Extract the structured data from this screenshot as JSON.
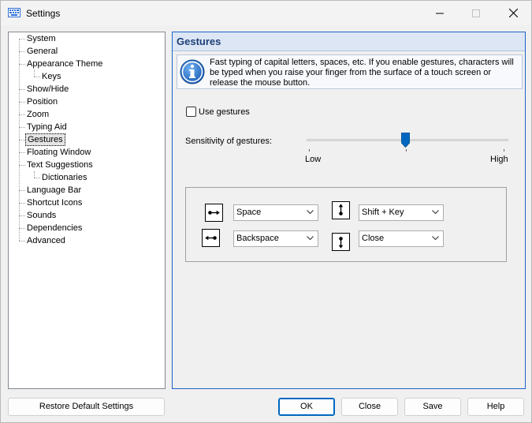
{
  "window": {
    "title": "Settings",
    "minimize_icon": "minimize-icon",
    "maximize_icon": "maximize-icon",
    "close_icon": "close-icon"
  },
  "tree": {
    "items": [
      {
        "label": "System"
      },
      {
        "label": "General"
      },
      {
        "label": "Appearance Theme"
      },
      {
        "label": "Keys"
      },
      {
        "label": "Show/Hide"
      },
      {
        "label": "Position"
      },
      {
        "label": "Zoom"
      },
      {
        "label": "Typing Aid"
      },
      {
        "label": "Gestures",
        "selected": true
      },
      {
        "label": "Floating Window"
      },
      {
        "label": "Text Suggestions"
      },
      {
        "label": "Dictionaries"
      },
      {
        "label": "Language Bar"
      },
      {
        "label": "Shortcut Icons"
      },
      {
        "label": "Sounds"
      },
      {
        "label": "Dependencies"
      },
      {
        "label": "Advanced"
      }
    ]
  },
  "panel": {
    "header": "Gestures",
    "info": "Fast typing of capital letters, spaces, etc. If you enable gestures, characters will be typed when you raise your finger from the surface of a touch screen or release the mouse button.",
    "use_gestures_label": "Use gestures",
    "use_gestures_checked": false,
    "sensitivity_label": "Sensitivity of gestures:",
    "slider": {
      "low_label": "Low",
      "high_label": "High",
      "value_fraction": 0.5
    },
    "gestures": {
      "right": {
        "icon": "swipe-right-icon",
        "value": "Space"
      },
      "up": {
        "icon": "swipe-up-icon",
        "value": "Shift + Key"
      },
      "left": {
        "icon": "swipe-left-icon",
        "value": "Backspace"
      },
      "down": {
        "icon": "swipe-down-icon",
        "value": "Close"
      }
    }
  },
  "buttons": {
    "restore": "Restore Default Settings",
    "ok": "OK",
    "close": "Close",
    "save": "Save",
    "help": "Help"
  },
  "colors": {
    "accent": "#0067c0",
    "panel_border": "#1e64c8",
    "header_bg": "#dce6f4",
    "header_text": "#1c3f78"
  }
}
